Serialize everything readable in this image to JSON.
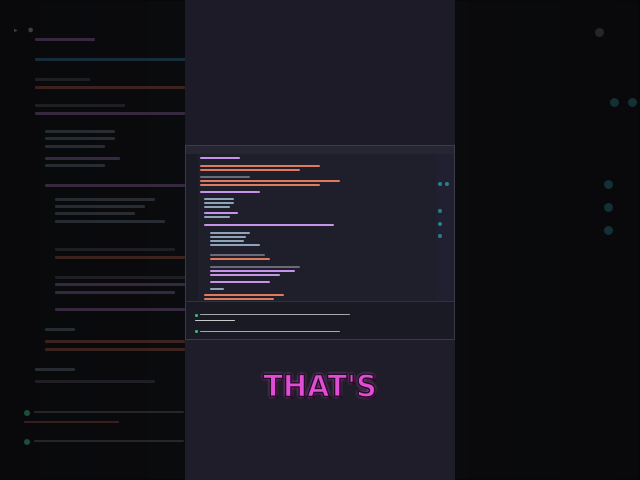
{
  "caption": {
    "text": "THAT'S"
  },
  "colors": {
    "caption": "#e14ed6",
    "center_panel": "#1e1d29",
    "background": "#15161b",
    "keyword": "#c792ea",
    "string": "#e07a5f",
    "plain": "#8fa3b8",
    "success": "#3bb27a"
  },
  "icons": [
    "run-icon",
    "debug-icon",
    "check-circle-icon",
    "wallet-icon"
  ]
}
